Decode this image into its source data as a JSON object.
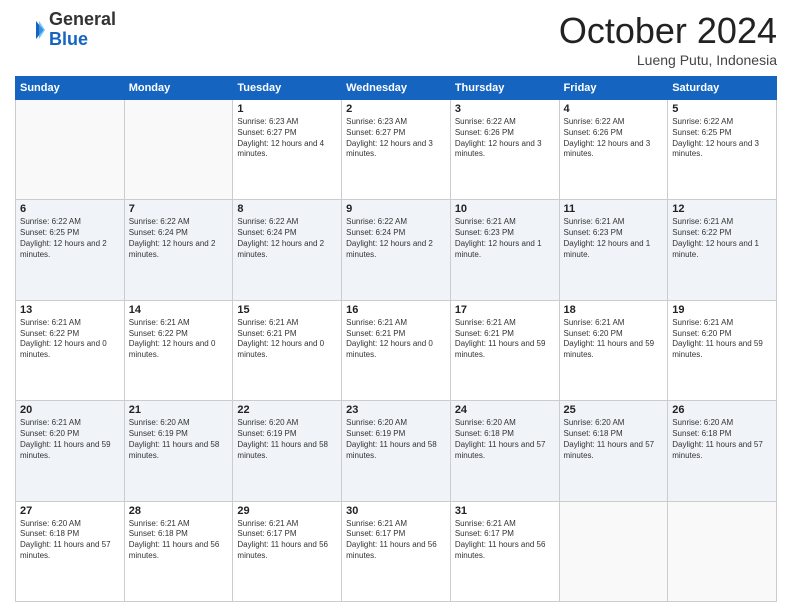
{
  "header": {
    "logo_general": "General",
    "logo_blue": "Blue",
    "month_title": "October 2024",
    "location": "Lueng Putu, Indonesia"
  },
  "days_of_week": [
    "Sunday",
    "Monday",
    "Tuesday",
    "Wednesday",
    "Thursday",
    "Friday",
    "Saturday"
  ],
  "weeks": [
    [
      {
        "day": "",
        "info": ""
      },
      {
        "day": "",
        "info": ""
      },
      {
        "day": "1",
        "info": "Sunrise: 6:23 AM\nSunset: 6:27 PM\nDaylight: 12 hours and 4 minutes."
      },
      {
        "day": "2",
        "info": "Sunrise: 6:23 AM\nSunset: 6:27 PM\nDaylight: 12 hours and 3 minutes."
      },
      {
        "day": "3",
        "info": "Sunrise: 6:22 AM\nSunset: 6:26 PM\nDaylight: 12 hours and 3 minutes."
      },
      {
        "day": "4",
        "info": "Sunrise: 6:22 AM\nSunset: 6:26 PM\nDaylight: 12 hours and 3 minutes."
      },
      {
        "day": "5",
        "info": "Sunrise: 6:22 AM\nSunset: 6:25 PM\nDaylight: 12 hours and 3 minutes."
      }
    ],
    [
      {
        "day": "6",
        "info": "Sunrise: 6:22 AM\nSunset: 6:25 PM\nDaylight: 12 hours and 2 minutes."
      },
      {
        "day": "7",
        "info": "Sunrise: 6:22 AM\nSunset: 6:24 PM\nDaylight: 12 hours and 2 minutes."
      },
      {
        "day": "8",
        "info": "Sunrise: 6:22 AM\nSunset: 6:24 PM\nDaylight: 12 hours and 2 minutes."
      },
      {
        "day": "9",
        "info": "Sunrise: 6:22 AM\nSunset: 6:24 PM\nDaylight: 12 hours and 2 minutes."
      },
      {
        "day": "10",
        "info": "Sunrise: 6:21 AM\nSunset: 6:23 PM\nDaylight: 12 hours and 1 minute."
      },
      {
        "day": "11",
        "info": "Sunrise: 6:21 AM\nSunset: 6:23 PM\nDaylight: 12 hours and 1 minute."
      },
      {
        "day": "12",
        "info": "Sunrise: 6:21 AM\nSunset: 6:22 PM\nDaylight: 12 hours and 1 minute."
      }
    ],
    [
      {
        "day": "13",
        "info": "Sunrise: 6:21 AM\nSunset: 6:22 PM\nDaylight: 12 hours and 0 minutes."
      },
      {
        "day": "14",
        "info": "Sunrise: 6:21 AM\nSunset: 6:22 PM\nDaylight: 12 hours and 0 minutes."
      },
      {
        "day": "15",
        "info": "Sunrise: 6:21 AM\nSunset: 6:21 PM\nDaylight: 12 hours and 0 minutes."
      },
      {
        "day": "16",
        "info": "Sunrise: 6:21 AM\nSunset: 6:21 PM\nDaylight: 12 hours and 0 minutes."
      },
      {
        "day": "17",
        "info": "Sunrise: 6:21 AM\nSunset: 6:21 PM\nDaylight: 11 hours and 59 minutes."
      },
      {
        "day": "18",
        "info": "Sunrise: 6:21 AM\nSunset: 6:20 PM\nDaylight: 11 hours and 59 minutes."
      },
      {
        "day": "19",
        "info": "Sunrise: 6:21 AM\nSunset: 6:20 PM\nDaylight: 11 hours and 59 minutes."
      }
    ],
    [
      {
        "day": "20",
        "info": "Sunrise: 6:21 AM\nSunset: 6:20 PM\nDaylight: 11 hours and 59 minutes."
      },
      {
        "day": "21",
        "info": "Sunrise: 6:20 AM\nSunset: 6:19 PM\nDaylight: 11 hours and 58 minutes."
      },
      {
        "day": "22",
        "info": "Sunrise: 6:20 AM\nSunset: 6:19 PM\nDaylight: 11 hours and 58 minutes."
      },
      {
        "day": "23",
        "info": "Sunrise: 6:20 AM\nSunset: 6:19 PM\nDaylight: 11 hours and 58 minutes."
      },
      {
        "day": "24",
        "info": "Sunrise: 6:20 AM\nSunset: 6:18 PM\nDaylight: 11 hours and 57 minutes."
      },
      {
        "day": "25",
        "info": "Sunrise: 6:20 AM\nSunset: 6:18 PM\nDaylight: 11 hours and 57 minutes."
      },
      {
        "day": "26",
        "info": "Sunrise: 6:20 AM\nSunset: 6:18 PM\nDaylight: 11 hours and 57 minutes."
      }
    ],
    [
      {
        "day": "27",
        "info": "Sunrise: 6:20 AM\nSunset: 6:18 PM\nDaylight: 11 hours and 57 minutes."
      },
      {
        "day": "28",
        "info": "Sunrise: 6:21 AM\nSunset: 6:18 PM\nDaylight: 11 hours and 56 minutes."
      },
      {
        "day": "29",
        "info": "Sunrise: 6:21 AM\nSunset: 6:17 PM\nDaylight: 11 hours and 56 minutes."
      },
      {
        "day": "30",
        "info": "Sunrise: 6:21 AM\nSunset: 6:17 PM\nDaylight: 11 hours and 56 minutes."
      },
      {
        "day": "31",
        "info": "Sunrise: 6:21 AM\nSunset: 6:17 PM\nDaylight: 11 hours and 56 minutes."
      },
      {
        "day": "",
        "info": ""
      },
      {
        "day": "",
        "info": ""
      }
    ]
  ]
}
